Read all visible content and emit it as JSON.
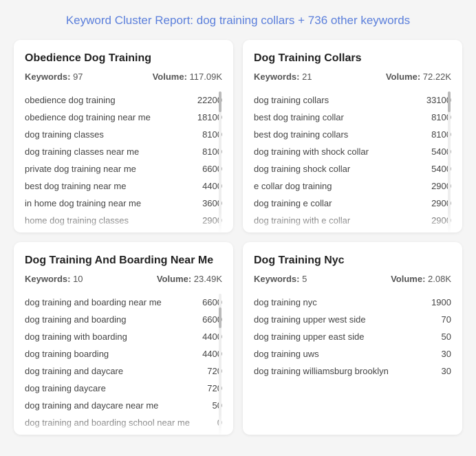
{
  "header": {
    "prefix": "Keyword Cluster Report:",
    "highlight": "dog training collars + 736 other keywords"
  },
  "cards": [
    {
      "id": "obedience-dog-training",
      "title": "Obedience Dog Training",
      "keywords_count": "97",
      "volume": "117.09K",
      "keywords_label": "Keywords:",
      "volume_label": "Volume:",
      "items": [
        {
          "name": "obedience dog training",
          "volume": "22200"
        },
        {
          "name": "obedience dog training near me",
          "volume": "18100"
        },
        {
          "name": "dog training classes",
          "volume": "8100"
        },
        {
          "name": "dog training classes near me",
          "volume": "8100"
        },
        {
          "name": "private dog training near me",
          "volume": "6600"
        },
        {
          "name": "best dog training near me",
          "volume": "4400"
        },
        {
          "name": "in home dog training near me",
          "volume": "3600"
        },
        {
          "name": "home dog training classes",
          "volume": "2900"
        }
      ],
      "has_scroll": true,
      "scroll_top": true
    },
    {
      "id": "dog-training-collars",
      "title": "Dog Training Collars",
      "keywords_count": "21",
      "volume": "72.22K",
      "keywords_label": "Keywords:",
      "volume_label": "Volume:",
      "items": [
        {
          "name": "dog training collars",
          "volume": "33100"
        },
        {
          "name": "best dog training collar",
          "volume": "8100"
        },
        {
          "name": "best dog training collars",
          "volume": "8100"
        },
        {
          "name": "dog training with shock collar",
          "volume": "5400"
        },
        {
          "name": "dog training shock collar",
          "volume": "5400"
        },
        {
          "name": "e collar dog training",
          "volume": "2900"
        },
        {
          "name": "dog training e collar",
          "volume": "2900"
        },
        {
          "name": "dog training with e collar",
          "volume": "2900"
        }
      ],
      "has_scroll": true,
      "scroll_top": true
    },
    {
      "id": "dog-training-boarding",
      "title": "Dog Training And Boarding Near Me",
      "keywords_count": "10",
      "volume": "23.49K",
      "keywords_label": "Keywords:",
      "volume_label": "Volume:",
      "items": [
        {
          "name": "dog training and boarding near me",
          "volume": "6600"
        },
        {
          "name": "dog training and boarding",
          "volume": "6600"
        },
        {
          "name": "dog training with boarding",
          "volume": "4400"
        },
        {
          "name": "dog training boarding",
          "volume": "4400"
        },
        {
          "name": "dog training and daycare",
          "volume": "720"
        },
        {
          "name": "dog training daycare",
          "volume": "720"
        },
        {
          "name": "dog training and daycare near me",
          "volume": "50"
        },
        {
          "name": "dog training and boarding school near me",
          "volume": "0"
        }
      ],
      "has_scroll": true,
      "scroll_top": false
    },
    {
      "id": "dog-training-nyc",
      "title": "Dog Training Nyc",
      "keywords_count": "5",
      "volume": "2.08K",
      "keywords_label": "Keywords:",
      "volume_label": "Volume:",
      "items": [
        {
          "name": "dog training nyc",
          "volume": "1900"
        },
        {
          "name": "dog training upper west side",
          "volume": "70"
        },
        {
          "name": "dog training upper east side",
          "volume": "50"
        },
        {
          "name": "dog training uws",
          "volume": "30"
        },
        {
          "name": "dog training williamsburg brooklyn",
          "volume": "30"
        }
      ],
      "has_scroll": false,
      "scroll_top": false
    }
  ]
}
